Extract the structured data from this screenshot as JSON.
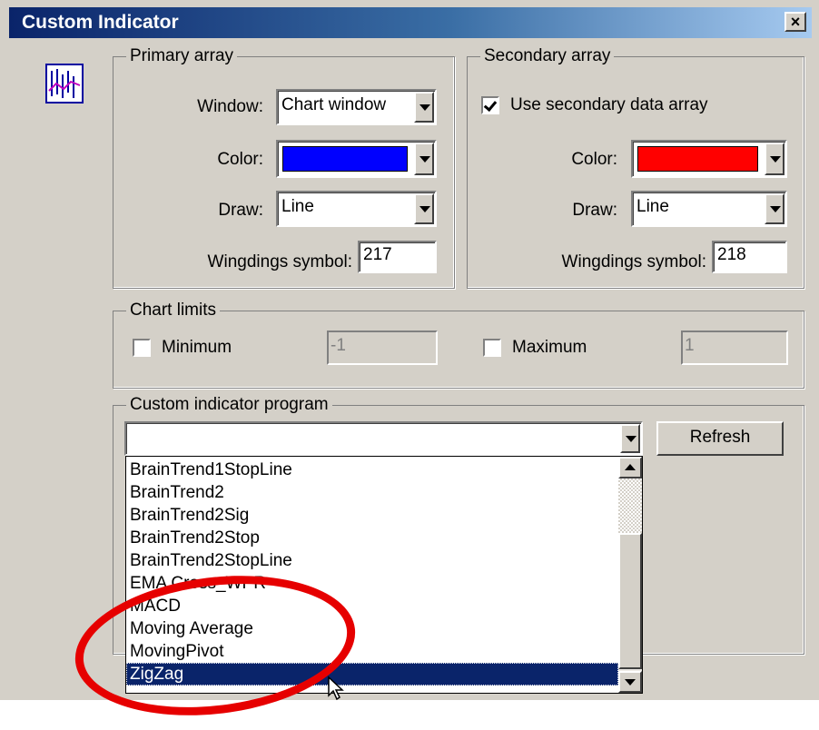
{
  "window": {
    "title": "Custom Indicator",
    "close_label": "×"
  },
  "primary": {
    "legend": "Primary array",
    "window_label": "Window:",
    "window_value": "Chart window",
    "color_label": "Color:",
    "color_value": "#0000ff",
    "draw_label": "Draw:",
    "draw_value": "Line",
    "wingdings_label": "Wingdings symbol:",
    "wingdings_value": "217"
  },
  "secondary": {
    "legend": "Secondary array",
    "use_secondary_label": "Use secondary data array",
    "use_secondary_checked": true,
    "color_label": "Color:",
    "color_value": "#ff0000",
    "draw_label": "Draw:",
    "draw_value": "Line",
    "wingdings_label": "Wingdings symbol:",
    "wingdings_value": "218"
  },
  "chart_limits": {
    "legend": "Chart limits",
    "minimum_label": "Minimum",
    "minimum_checked": false,
    "minimum_value": "-1",
    "maximum_label": "Maximum",
    "maximum_checked": false,
    "maximum_value": "1"
  },
  "program": {
    "legend": "Custom indicator program",
    "selected_value": "",
    "refresh_label": "Refresh",
    "items": [
      "BrainTrend1StopLine",
      "BrainTrend2",
      "BrainTrend2Sig",
      "BrainTrend2Stop",
      "BrainTrend2StopLine",
      "EMA Cross_WPR",
      "MACD",
      "Moving Average",
      "MovingPivot",
      "ZigZag"
    ],
    "highlighted_item": "ZigZag"
  },
  "colors": {
    "annotation": "#e60000",
    "selection": "#0a246a"
  }
}
